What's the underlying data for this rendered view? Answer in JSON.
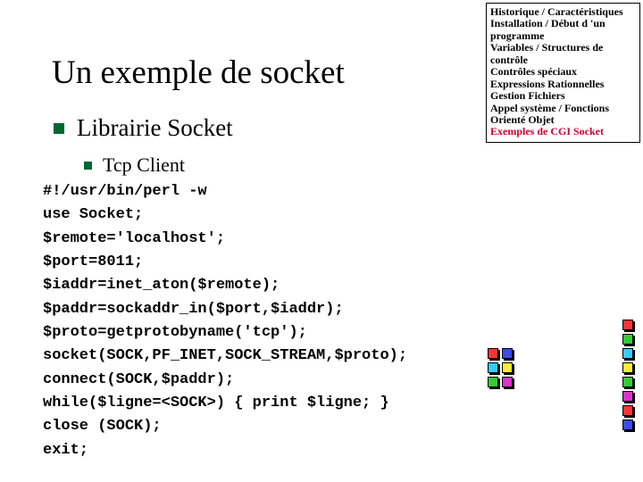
{
  "title": "Un exemple de socket",
  "sub1": "Librairie Socket",
  "sub2": "Tcp Client",
  "code": "#!/usr/bin/perl -w\nuse Socket;\n$remote='localhost';\n$port=8011;\n$iaddr=inet_aton($remote);\n$paddr=sockaddr_in($port,$iaddr);\n$proto=getprotobyname('tcp');\nsocket(SOCK,PF_INET,SOCK_STREAM,$proto);\nconnect(SOCK,$paddr);\nwhile($ligne=<SOCK>) { print $ligne; }\nclose (SOCK);\nexit;",
  "sidebar": {
    "items": [
      "Historique / Caractéristiques",
      "Installation / Début d 'un programme",
      "Variables  / Structures de contrôle",
      "Contrôles spéciaux",
      " Expressions Rationnelles",
      " Gestion Fichiers",
      "Appel système / Fonctions",
      " Orienté Objet",
      "Exemples de CGI Socket"
    ],
    "highlight_index": 8
  },
  "chart_data": {
    "type": "table",
    "sidebar_outline": [
      "Historique / Caractéristiques",
      "Installation / Début d 'un programme",
      "Variables / Structures de contrôle",
      "Contrôles spéciaux",
      "Expressions Rationnelles",
      "Gestion Fichiers",
      "Appel système / Fonctions",
      "Orienté Objet",
      "Exemples de CGI Socket"
    ],
    "current_section": "Exemples de CGI Socket"
  }
}
